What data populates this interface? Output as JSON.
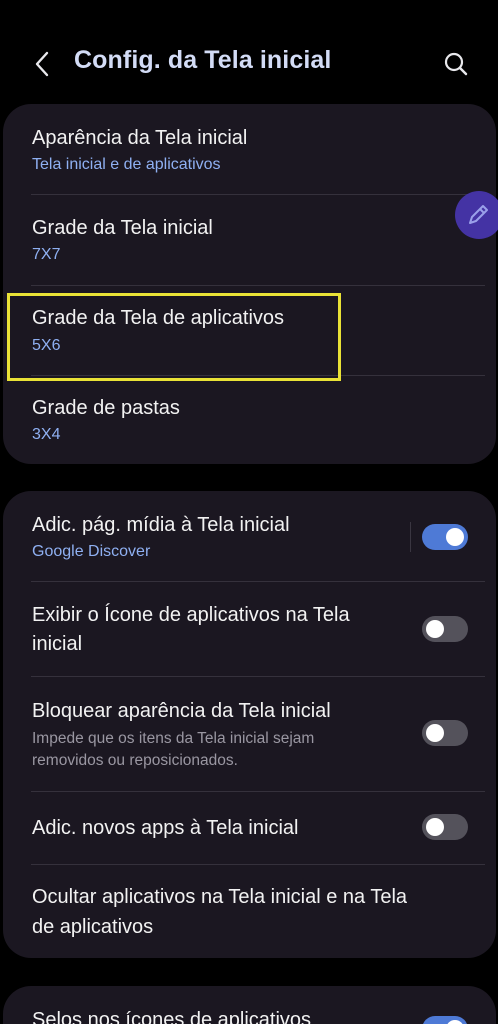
{
  "header": {
    "title": "Config. da Tela inicial",
    "back_icon": "chevron-left-icon",
    "search_icon": "search-icon"
  },
  "grid_card": {
    "items": [
      {
        "label": "Aparência da Tela inicial",
        "value": "Tela inicial e de aplicativos"
      },
      {
        "label": "Grade da Tela inicial",
        "value": "7X7"
      },
      {
        "label": "Grade da Tela de aplicativos",
        "value": "5X6"
      },
      {
        "label": "Grade de pastas",
        "value": "3X4"
      }
    ]
  },
  "toggle_card": {
    "items": [
      {
        "label": "Adic. pág. mídia à Tela inicial",
        "value": "Google Discover",
        "toggle_on": true
      },
      {
        "label_line1": "Exibir o Ícone de aplicativos na Tela",
        "label_line2": "inicial",
        "toggle_on": false
      },
      {
        "label": "Bloquear aparência da Tela inicial",
        "desc_line1": "Impede que os itens da Tela inicial sejam",
        "desc_line2": "removidos ou reposicionados.",
        "toggle_on": false
      },
      {
        "label": "Adic. novos apps à Tela inicial",
        "toggle_on": false
      },
      {
        "label_line1": "Ocultar aplicativos na Tela inicial e na Tela",
        "label_line2": "de aplicativos"
      }
    ]
  },
  "bottom_card": {
    "items": [
      {
        "label": "Selos nos ícones de aplicativos",
        "toggle_on": true
      }
    ]
  },
  "colors": {
    "accent": "#4e7ad6",
    "subtitle_blue": "#8fb0f2",
    "title_blue": "#d3dcf6",
    "highlight": "#e9e236",
    "card_bg": "#1b1721",
    "floating_button": "#4433a4"
  },
  "floating_button_icon": "pencil-icon"
}
